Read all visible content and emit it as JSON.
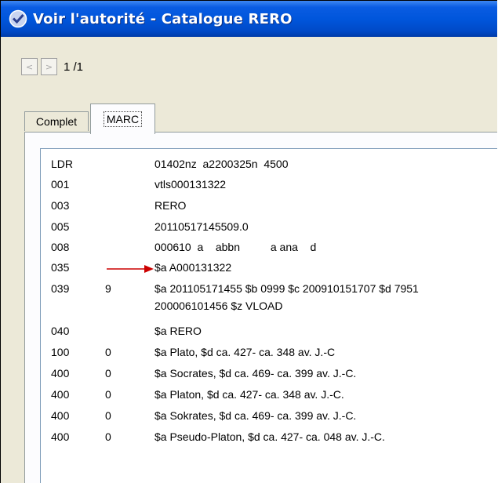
{
  "window": {
    "title": "Voir l'autorité - Catalogue RERO"
  },
  "nav": {
    "prev": "<",
    "next": ">",
    "pager": "1 /1"
  },
  "tabs": [
    {
      "label": "Complet",
      "active": false
    },
    {
      "label": "MARC",
      "active": true
    }
  ],
  "colors": {
    "titlebar": "#0056dc",
    "arrow": "#cc0000"
  },
  "marc": {
    "rows": [
      {
        "tag": "LDR",
        "ind": "",
        "value": "01402nz  a2200325n  4500"
      },
      {
        "tag": "001",
        "ind": "",
        "value": "vtls000131322"
      },
      {
        "tag": "003",
        "ind": "",
        "value": "RERO"
      },
      {
        "tag": "005",
        "ind": "",
        "value": "20110517145509.0"
      },
      {
        "tag": "008",
        "ind": "",
        "value": "000610  a    abbn          a ana    d"
      },
      {
        "tag": "035",
        "ind": "",
        "value": "$a A000131322"
      },
      {
        "tag": "039",
        "ind": "9",
        "value": "$a 201105171455 $b 0999 $c 200910151707 $d 7951",
        "value2": "200006101456 $z VLOAD"
      },
      {
        "tag": "040",
        "ind": "",
        "value": "$a RERO"
      },
      {
        "tag": "100",
        "ind": "0",
        "value": "$a Plato, $d ca. 427- ca. 348 av. J.-C"
      },
      {
        "tag": "400",
        "ind": "0",
        "value": "$a Socrates, $d ca. 469- ca. 399 av. J.-C."
      },
      {
        "tag": "400",
        "ind": "0",
        "value": "$a Platon, $d ca. 427- ca. 348 av. J.-C."
      },
      {
        "tag": "400",
        "ind": "0",
        "value": "$a Sokrates, $d ca. 469- ca. 399 av. J.-C."
      },
      {
        "tag": "400",
        "ind": "0",
        "value": "$a Pseudo-Platon, $d ca. 427- ca. 048 av. J.-C."
      }
    ]
  }
}
